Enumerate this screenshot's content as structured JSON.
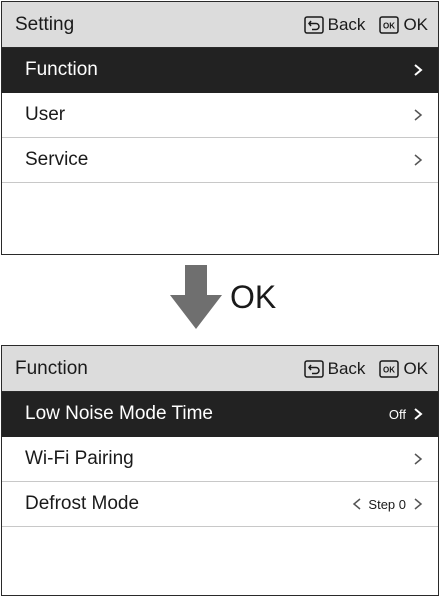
{
  "screen1": {
    "header": {
      "title": "Setting",
      "back_label": "Back",
      "ok_icon_text": "OK",
      "ok_label": "OK"
    },
    "items": [
      {
        "label": "Function"
      },
      {
        "label": "User"
      },
      {
        "label": "Service"
      }
    ]
  },
  "transition": {
    "label": "OK"
  },
  "screen2": {
    "header": {
      "title": "Function",
      "back_label": "Back",
      "ok_icon_text": "OK",
      "ok_label": "OK"
    },
    "items": [
      {
        "label": "Low Noise Mode Time",
        "value": "Off"
      },
      {
        "label": "Wi-Fi Pairing"
      },
      {
        "label": "Defrost Mode",
        "value": "Step 0"
      }
    ]
  },
  "colors": {
    "header_bg": "#dcdcdc",
    "selected_bg": "#222222",
    "border": "#2a2a2a",
    "arrow": "#6f6f6f"
  }
}
